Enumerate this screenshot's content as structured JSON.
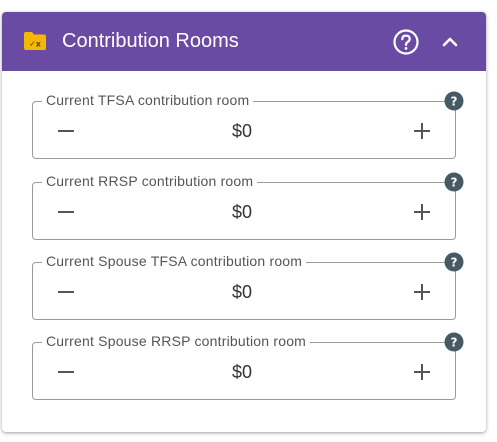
{
  "header": {
    "title": "Contribution Rooms",
    "color": "#6a4ba3",
    "icon": "folder-check-icon",
    "help_icon": "help-circle-icon",
    "collapse_icon": "chevron-up-icon"
  },
  "fields": [
    {
      "label": "Current TFSA contribution room",
      "value": "$0"
    },
    {
      "label": "Current RRSP contribution room",
      "value": "$0"
    },
    {
      "label": "Current Spouse TFSA contribution room",
      "value": "$0"
    },
    {
      "label": "Current Spouse RRSP contribution room",
      "value": "$0"
    }
  ],
  "colors": {
    "accent": "#6a4ba3",
    "folder": "#f5b800",
    "help_badge": "#455a64"
  }
}
